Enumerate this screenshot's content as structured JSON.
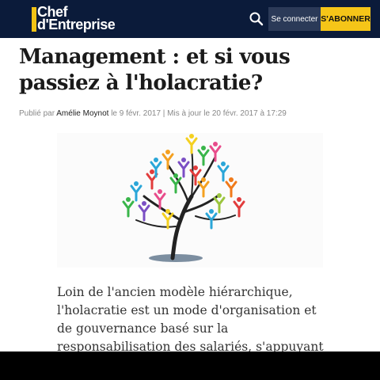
{
  "header": {
    "logo_line1": "Chef",
    "logo_line2": "d'Entreprise",
    "login_label": "Se connecter",
    "subscribe_label": "S'ABONNER",
    "search_icon": "search-icon"
  },
  "article": {
    "title": "Management : et si vous passiez à l'holacratie?",
    "meta_prefix": "Publié par",
    "author": "Amélie Moynot",
    "meta_rest": "le 9 févr. 2017 | Mis à jour le 20 févr. 2017 à 17:29",
    "lead": "Loin de l'ancien modèle hiérarchique, l'holacratie est un mode d'organisation et de gouvernance basé sur la responsabilisation des salariés, s'appuyant sur une charte précise."
  },
  "colors": {
    "header_bg": "#0b1b3a",
    "accent": "#f5c518"
  }
}
